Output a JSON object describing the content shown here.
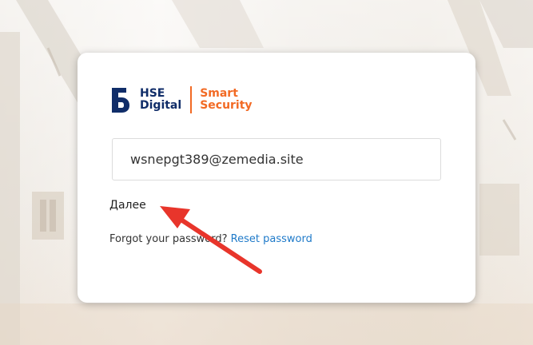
{
  "brand": {
    "hse_line1": "HSE",
    "hse_line2": "Digital",
    "product_line1": "Smart",
    "product_line2": "Security",
    "colors": {
      "hse_blue": "#102d69",
      "accent_orange": "#f26a24"
    }
  },
  "login": {
    "email_value": "wsnepgt389@zemedia.site",
    "next_label": "Далее",
    "forgot_text": "Forgot your password?",
    "reset_label": "Reset password"
  },
  "annotation": {
    "arrow_color": "#e8352b",
    "icon": "red-arrow-pointer"
  }
}
